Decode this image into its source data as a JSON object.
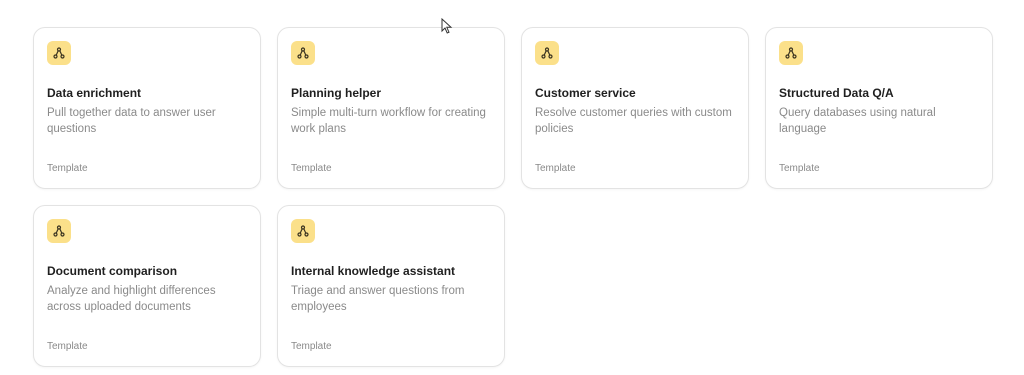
{
  "cards": [
    {
      "title": "Data enrichment",
      "description": "Pull together data to answer user questions",
      "tag": "Template",
      "icon": "workflow-icon"
    },
    {
      "title": "Planning helper",
      "description": "Simple multi-turn workflow for creating work plans",
      "tag": "Template",
      "icon": "workflow-icon"
    },
    {
      "title": "Customer service",
      "description": "Resolve customer queries with custom policies",
      "tag": "Template",
      "icon": "workflow-icon"
    },
    {
      "title": "Structured Data Q/A",
      "description": "Query databases using natural language",
      "tag": "Template",
      "icon": "workflow-icon"
    },
    {
      "title": "Document comparison",
      "description": "Analyze and highlight differences across uploaded documents",
      "tag": "Template",
      "icon": "workflow-icon"
    },
    {
      "title": "Internal knowledge assistant",
      "description": "Triage and answer questions from employees",
      "tag": "Template",
      "icon": "workflow-icon"
    }
  ],
  "colors": {
    "icon_badge": "#fbe08a",
    "icon_stroke": "#3a3320",
    "title": "#1f1f1f",
    "muted": "#8a8a8a",
    "card_border": "#e3e3e3"
  }
}
